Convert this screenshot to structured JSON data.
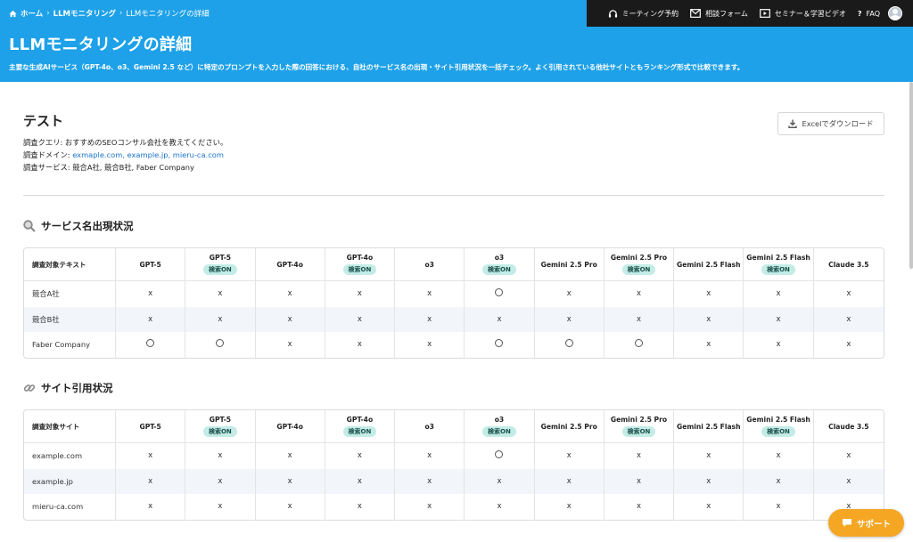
{
  "breadcrumb": {
    "home": "ホーム",
    "parent": "LLMモニタリング",
    "current": "LLMモニタリングの詳細"
  },
  "header": {
    "title": "LLMモニタリングの詳細",
    "description": "主要な生成AIサービス（GPT-4o、o3、Gemini 2.5 など）に特定のプロンプトを入力した際の回答における、自社のサービス名の出現・サイト引用状況を一括チェック。よく引用されている他社サイトともランキング形式で比較できます。"
  },
  "topnav": {
    "meeting": "ミーティング予約",
    "contact": "相談フォーム",
    "seminar": "セミナー＆学習ビデオ",
    "faq": "FAQ"
  },
  "report": {
    "name": "テスト",
    "query_label": "調査クエリ: ",
    "query": "おすすめのSEOコンサル会社を教えてください。",
    "domain_label": "調査ドメイン: ",
    "domains": "exmaple.com, example.jp, mieru-ca.com",
    "service_label": "調査サービス: ",
    "services": "競合A社, 競合B社, Faber Company",
    "download_label": "Excelでダウンロード"
  },
  "models": [
    {
      "name": "GPT-5",
      "badge": ""
    },
    {
      "name": "GPT-5",
      "badge": "検索ON"
    },
    {
      "name": "GPT-4o",
      "badge": ""
    },
    {
      "name": "GPT-4o",
      "badge": "検索ON"
    },
    {
      "name": "o3",
      "badge": ""
    },
    {
      "name": "o3",
      "badge": "検索ON"
    },
    {
      "name": "Gemini 2.5 Pro",
      "badge": ""
    },
    {
      "name": "Gemini 2.5 Pro",
      "badge": "検索ON"
    },
    {
      "name": "Gemini 2.5 Flash",
      "badge": ""
    },
    {
      "name": "Gemini 2.5 Flash",
      "badge": "検索ON"
    },
    {
      "name": "Claude 3.5",
      "badge": ""
    }
  ],
  "service_section": {
    "title": "サービス名出現状況",
    "header_label": "調査対象テキスト",
    "rows": [
      {
        "label": "競合A社",
        "cells": [
          "x",
          "x",
          "x",
          "x",
          "x",
          "○",
          "x",
          "x",
          "x",
          "x",
          "x"
        ]
      },
      {
        "label": "競合B社",
        "cells": [
          "x",
          "x",
          "x",
          "x",
          "x",
          "x",
          "x",
          "x",
          "x",
          "x",
          "x"
        ]
      },
      {
        "label": "Faber Company",
        "cells": [
          "○",
          "○",
          "x",
          "x",
          "x",
          "○",
          "○",
          "○",
          "x",
          "x",
          "x"
        ]
      }
    ]
  },
  "site_section": {
    "title": "サイト引用状況",
    "header_label": "調査対象サイト",
    "rows": [
      {
        "label": "example.com",
        "cells": [
          "x",
          "x",
          "x",
          "x",
          "x",
          "○",
          "x",
          "x",
          "x",
          "x",
          "x"
        ]
      },
      {
        "label": "example.jp",
        "cells": [
          "x",
          "x",
          "x",
          "x",
          "x",
          "x",
          "x",
          "x",
          "x",
          "x",
          "x"
        ]
      },
      {
        "label": "mieru-ca.com",
        "cells": [
          "x",
          "x",
          "x",
          "x",
          "x",
          "x",
          "x",
          "x",
          "x",
          "x",
          "x"
        ]
      }
    ]
  },
  "support": {
    "label": "サポート"
  },
  "colors": {
    "hero": "#1ea1e8",
    "topbar": "#1a1a1a",
    "link": "#1a73c8",
    "badge": "#c3ece6",
    "support": "#f5a623"
  }
}
